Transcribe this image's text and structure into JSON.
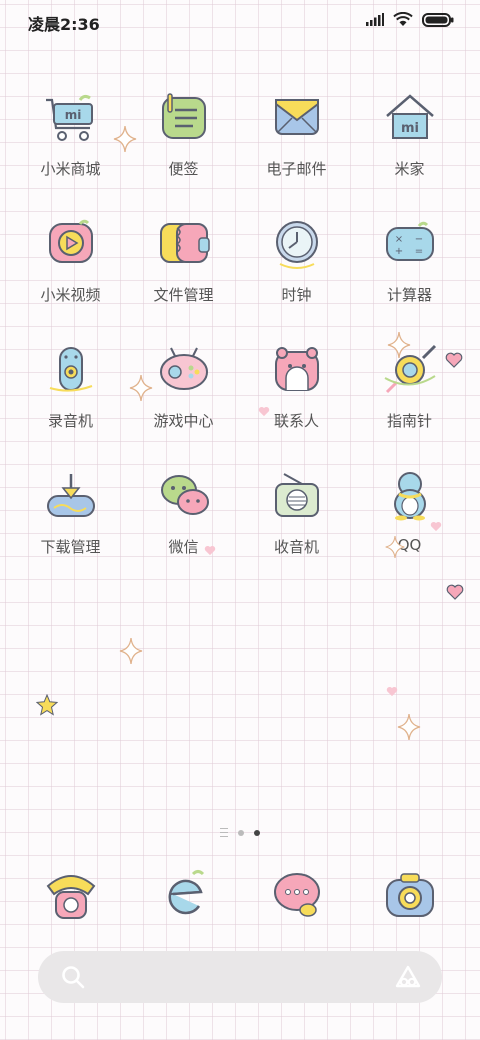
{
  "status_bar": {
    "time": "凌晨2:36"
  },
  "apps": [
    {
      "label": "小米商城",
      "icon": "mi-store-cart-icon"
    },
    {
      "label": "便签",
      "icon": "notes-icon"
    },
    {
      "label": "电子邮件",
      "icon": "email-envelope-icon"
    },
    {
      "label": "米家",
      "icon": "mi-home-house-icon"
    },
    {
      "label": "小米视频",
      "icon": "video-play-icon"
    },
    {
      "label": "文件管理",
      "icon": "file-manager-icon"
    },
    {
      "label": "时钟",
      "icon": "clock-icon"
    },
    {
      "label": "计算器",
      "icon": "calculator-icon"
    },
    {
      "label": "录音机",
      "icon": "recorder-icon"
    },
    {
      "label": "游戏中心",
      "icon": "game-center-icon"
    },
    {
      "label": "联系人",
      "icon": "contacts-icon"
    },
    {
      "label": "指南针",
      "icon": "compass-icon"
    },
    {
      "label": "下载管理",
      "icon": "download-icon"
    },
    {
      "label": "微信",
      "icon": "wechat-icon"
    },
    {
      "label": "收音机",
      "icon": "radio-icon"
    },
    {
      "label": "QQ",
      "icon": "qq-penguin-icon"
    }
  ],
  "dock": [
    {
      "icon": "phone-icon"
    },
    {
      "icon": "browser-icon"
    },
    {
      "icon": "messages-icon"
    },
    {
      "icon": "camera-icon"
    }
  ],
  "page_indicator": {
    "pages": 2,
    "active": 2
  },
  "search_bar": {
    "icon_left": "search-icon",
    "icon_right": "assistant-icon"
  },
  "colors": {
    "pink": "#f6a7b9",
    "blue": "#a8d8ea",
    "yellow": "#f7dc5a",
    "green": "#b9d98c",
    "outline": "#5a6070"
  }
}
